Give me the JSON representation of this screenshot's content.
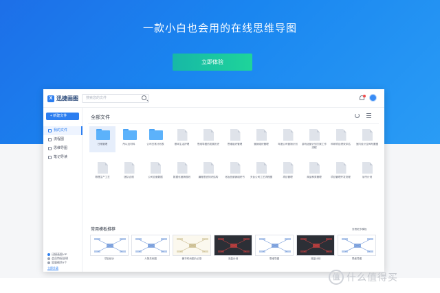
{
  "hero": {
    "title": "一款小白也会用的在线思维导图",
    "cta_label": "立即体验",
    "colors": {
      "gradient_start": "#1d6fe8",
      "gradient_end": "#2a9cf5",
      "cta_start": "#17b8a6",
      "cta_end": "#1ed49a"
    }
  },
  "app": {
    "brand": "迅捷画图",
    "logo_glyph": "X",
    "search_placeholder": "搜索您的文件",
    "new_button": "+ 新建文件",
    "sidebar": [
      {
        "label": "我的文件",
        "active": true,
        "icon": "file-icon"
      },
      {
        "label": "流程图",
        "active": false,
        "icon": "flowchart-icon"
      },
      {
        "label": "思维导图",
        "active": false,
        "icon": "mindmap-icon"
      },
      {
        "label": "笔记导读",
        "active": false,
        "icon": "note-icon"
      }
    ],
    "vip": {
      "line1": "迅捷画图VIP",
      "line2": "会员特权说明",
      "line3": "容量剩余9个",
      "link": "立即升级"
    },
    "main_title": "全部文件",
    "files": [
      {
        "name": "日常管理",
        "type": "folder",
        "selected": true
      },
      {
        "name": "所以出材料",
        "type": "folder"
      },
      {
        "name": "公司日常计划表",
        "type": "folder"
      },
      {
        "name": "基本生活护理",
        "type": "doc"
      },
      {
        "name": "思维导图的发展历史",
        "type": "doc"
      },
      {
        "name": "思维组织管理",
        "type": "doc"
      },
      {
        "name": "营销组织管理",
        "type": "doc"
      },
      {
        "name": "年度公司营销计划",
        "type": "doc"
      },
      {
        "name": "游戏运营计划方案工作流程",
        "type": "doc"
      },
      {
        "name": "科研项目绩效评估",
        "type": "doc"
      },
      {
        "name": "室内设计空间布置图",
        "type": "doc"
      },
      {
        "name": "物理生产工艺",
        "type": "doc"
      },
      {
        "name": "团队合规",
        "type": "doc"
      },
      {
        "name": "公司自营数据",
        "type": "doc"
      },
      {
        "name": "数据化营销规划",
        "type": "doc"
      },
      {
        "name": "编程语言知识结构",
        "type": "doc"
      },
      {
        "name": "化妆品营销组织书",
        "type": "doc"
      },
      {
        "name": "天台公司工艺流程图",
        "type": "doc"
      },
      {
        "name": "项目管理",
        "type": "doc"
      },
      {
        "name": "商品种类管理",
        "type": "doc"
      },
      {
        "name": "项目管理开发流程",
        "type": "doc"
      },
      {
        "name": "读书计划",
        "type": "doc"
      }
    ],
    "templates_title": "常用模板推荐",
    "templates_more": "查看更多模板",
    "templates": [
      {
        "name": "项目统计",
        "style": "light"
      },
      {
        "name": "人物关系图",
        "style": "light"
      },
      {
        "name": "奢华时尚图片记录",
        "style": "cream"
      },
      {
        "name": "流量计划",
        "style": "dark"
      },
      {
        "name": "思维导图",
        "style": "light"
      },
      {
        "name": "流量计划",
        "style": "dark"
      },
      {
        "name": "思维导图",
        "style": "light"
      }
    ]
  },
  "watermark": {
    "glyph": "值",
    "text": "什么值得买"
  }
}
